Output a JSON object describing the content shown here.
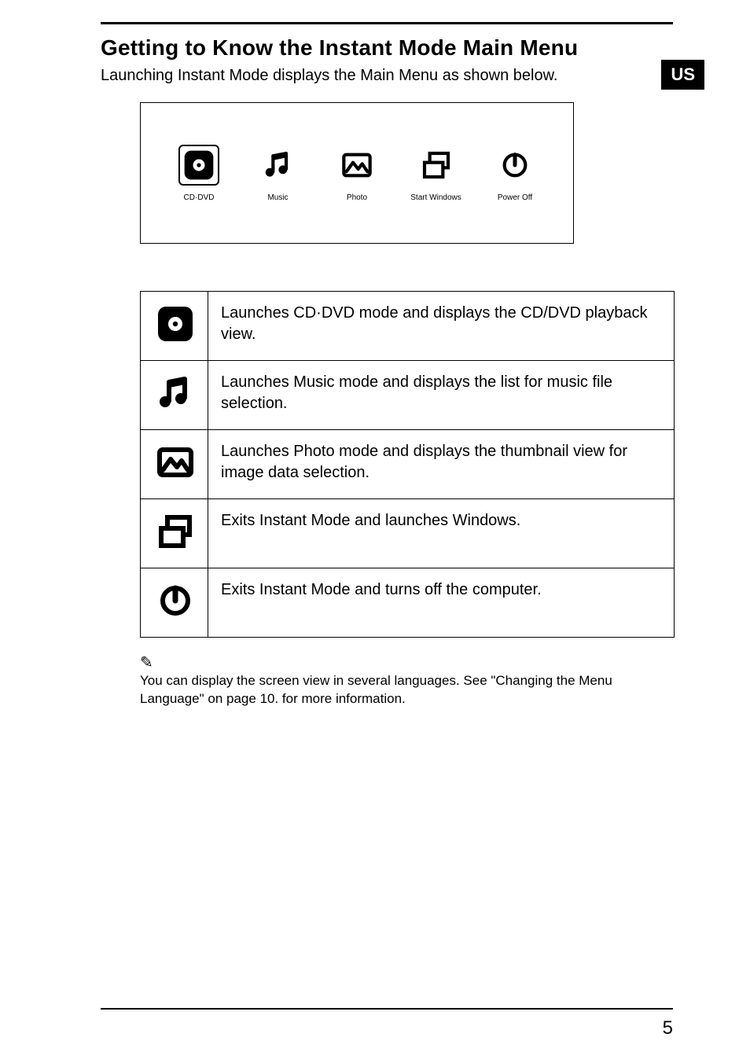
{
  "region": "US",
  "heading": "Getting to Know the Instant Mode Main Menu",
  "subheading": "Launching Instant Mode displays the Main Menu as shown below.",
  "menu": {
    "items": [
      {
        "id": "cd-dvd",
        "label": "CD·DVD",
        "icon": "disc-icon",
        "selected": true
      },
      {
        "id": "music",
        "label": "Music",
        "icon": "music-icon",
        "selected": false
      },
      {
        "id": "photo",
        "label": "Photo",
        "icon": "photo-icon",
        "selected": false
      },
      {
        "id": "start-windows",
        "label": "Start Windows",
        "icon": "windows-icon",
        "selected": false
      },
      {
        "id": "power-off",
        "label": "Power Off",
        "icon": "power-icon",
        "selected": false
      }
    ]
  },
  "descriptions": [
    {
      "icon": "disc-icon",
      "text": "Launches CD·DVD mode and displays the CD/DVD playback view."
    },
    {
      "icon": "music-icon",
      "text": "Launches Music mode and displays the list for music file selection."
    },
    {
      "icon": "photo-icon",
      "text": "Launches Photo mode and displays the thumbnail view for image data selection."
    },
    {
      "icon": "windows-icon",
      "text": "Exits Instant Mode and launches Windows."
    },
    {
      "icon": "power-icon",
      "text": "Exits Instant Mode and turns off the computer."
    }
  ],
  "note": {
    "icon": "✎",
    "text": "You can display the screen view in several languages. See \"Changing the Menu Language\" on page 10. for more information."
  },
  "page_number": "5"
}
